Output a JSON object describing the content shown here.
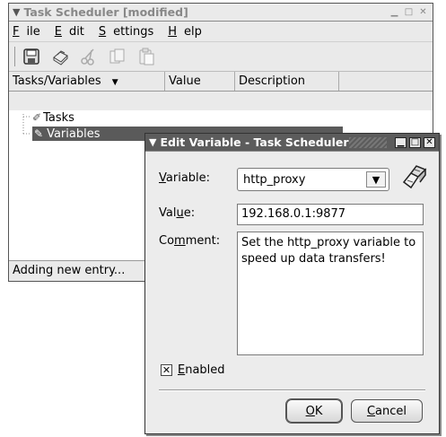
{
  "main_window": {
    "title": "Task Scheduler [modified]",
    "menu": [
      {
        "label": "File",
        "mnemonic": "F",
        "rest": "ile"
      },
      {
        "label": "Edit",
        "mnemonic": "E",
        "rest": "dit"
      },
      {
        "label": "Settings",
        "mnemonic": "S",
        "rest": "ettings"
      },
      {
        "label": "Help",
        "mnemonic": "H",
        "rest": "elp"
      }
    ],
    "toolbar_icons": [
      "save-icon",
      "print-icon",
      "cut-icon",
      "copy-icon",
      "paste-icon"
    ],
    "columns": [
      "Tasks/Variables",
      "Value",
      "Description"
    ],
    "tree": [
      {
        "label": "Tasks",
        "selected": false
      },
      {
        "label": "Variables",
        "selected": true
      }
    ],
    "status": "Adding new entry..."
  },
  "dialog": {
    "title": "Edit Variable - Task Scheduler",
    "variable_label": {
      "m": "V",
      "rest": "ariable:"
    },
    "variable_value": "http_proxy",
    "value_label": {
      "pre": "Val",
      "m": "u",
      "rest": "e:"
    },
    "value_value": "192.168.0.1:9877",
    "comment_label": {
      "pre": "Co",
      "m": "m",
      "rest": "ment:"
    },
    "comment_value": "Set the http_proxy variable to\nspeed up data transfers!",
    "enabled_label": {
      "m": "E",
      "rest": "nabled"
    },
    "enabled_checked": true,
    "ok_label": {
      "m": "O",
      "rest": "K"
    },
    "cancel_label": {
      "m": "C",
      "rest": "ancel"
    }
  }
}
